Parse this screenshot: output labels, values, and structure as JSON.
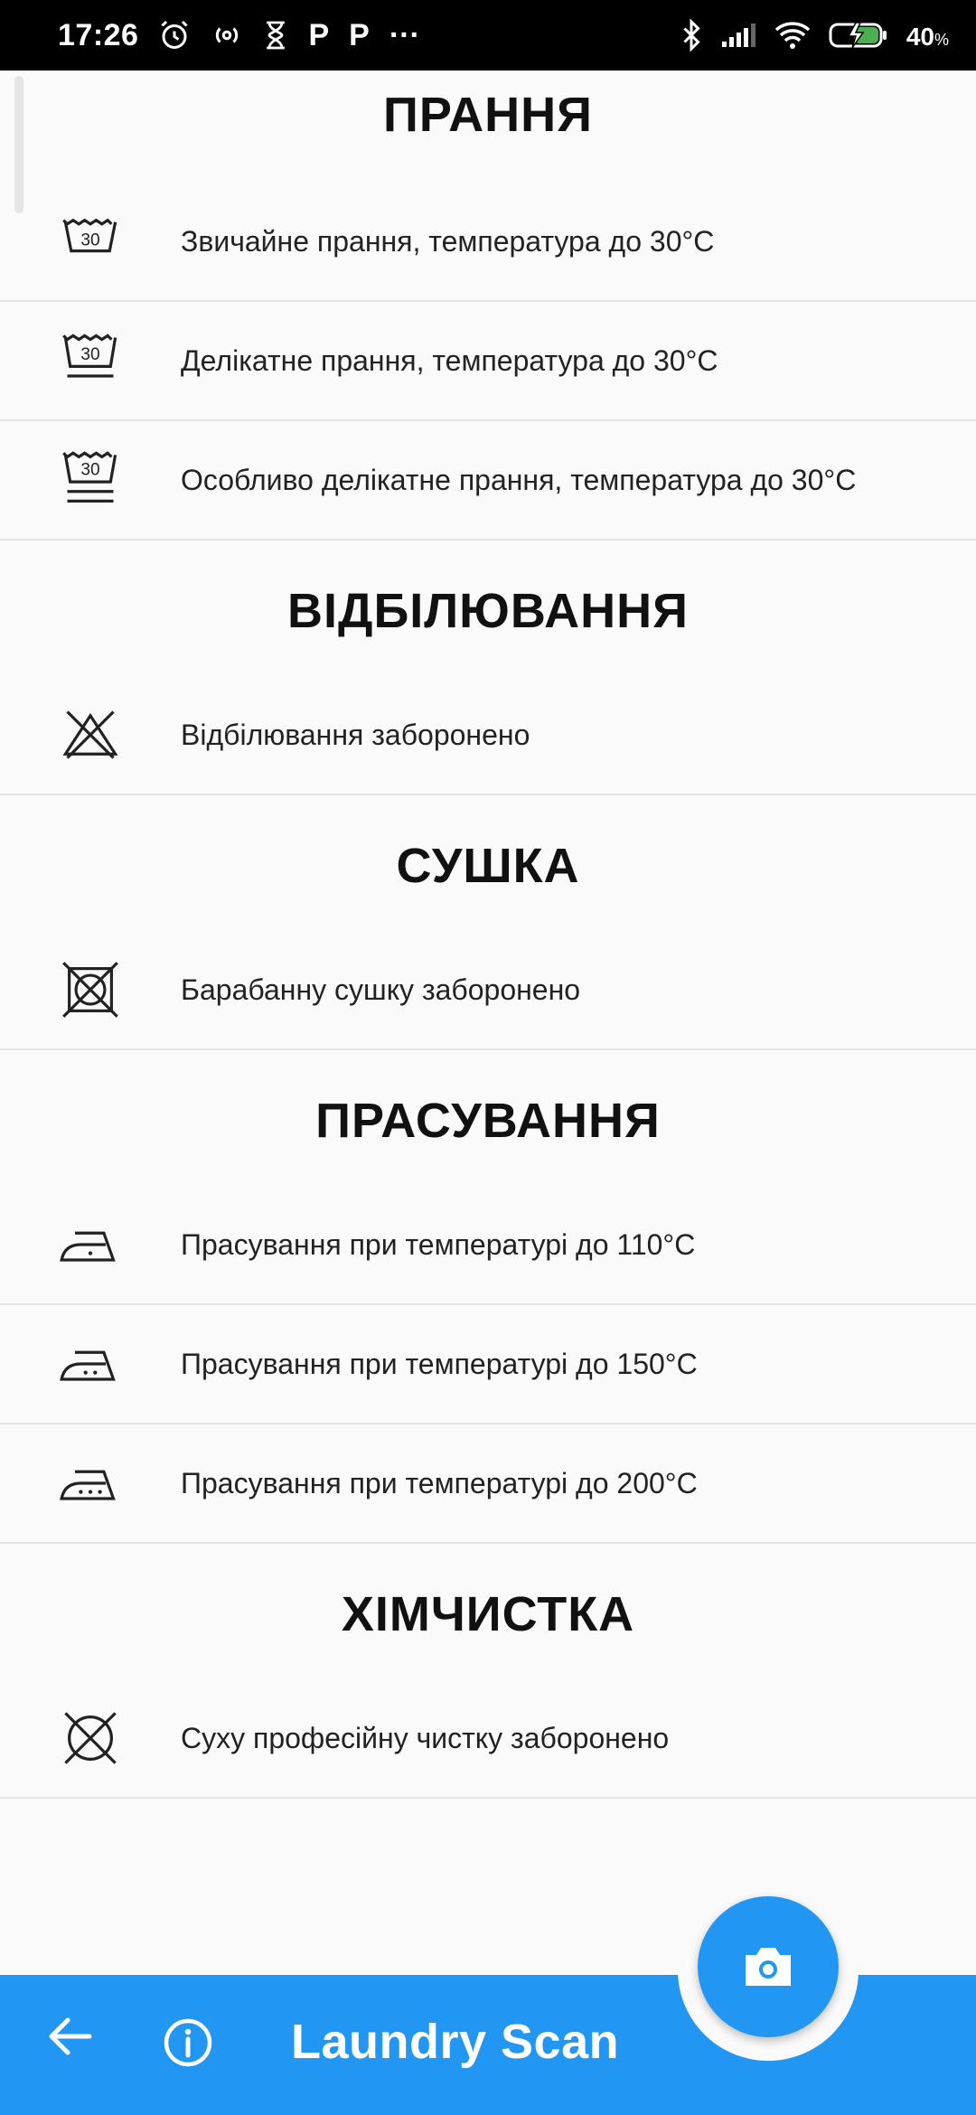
{
  "status_bar": {
    "time": "17:26",
    "battery_percent": "40",
    "battery_unit": "%",
    "p_label": "P",
    "more": "···"
  },
  "sections": [
    {
      "title": "ПРАННЯ",
      "items": [
        {
          "icon": "wash-30-icon",
          "label": "Звичайне прання, температура до 30°C",
          "icon_text": "30"
        },
        {
          "icon": "wash-30-gentle-icon",
          "label": "Делікатне прання, температура до 30°C",
          "icon_text": "30"
        },
        {
          "icon": "wash-30-very-gentle-icon",
          "label": "Особливо делікатне прання, температура до 30°C",
          "icon_text": "30"
        }
      ]
    },
    {
      "title": "ВІДБІЛЮВАННЯ",
      "items": [
        {
          "icon": "no-bleach-icon",
          "label": "Відбілювання заборонено"
        }
      ]
    },
    {
      "title": "СУШКА",
      "items": [
        {
          "icon": "no-tumble-dry-icon",
          "label": "Барабанну сушку заборонено"
        }
      ]
    },
    {
      "title": "ПРАСУВАННЯ",
      "items": [
        {
          "icon": "iron-110-icon",
          "label": "Прасування при температурі до 110°C"
        },
        {
          "icon": "iron-150-icon",
          "label": "Прасування при температурі до 150°C"
        },
        {
          "icon": "iron-200-icon",
          "label": "Прасування при температурі до 200°C"
        }
      ]
    },
    {
      "title": "ХІМЧИСТКА",
      "items": [
        {
          "icon": "no-dry-clean-icon",
          "label": "Суху професійну чистку заборонено"
        }
      ]
    }
  ],
  "bottom_bar": {
    "title": "Laundry Scan",
    "accent_color": "#2196f3",
    "back_icon": "arrow-left-icon",
    "info_icon": "info-icon",
    "fab_icon": "camera-icon"
  }
}
